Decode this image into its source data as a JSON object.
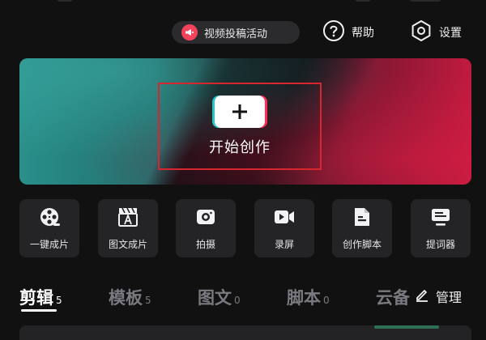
{
  "topbar": {
    "promo_label": "视频投稿活动",
    "help_label": "帮助",
    "settings_label": "设置"
  },
  "banner": {
    "create_label": "开始创作"
  },
  "tools": [
    {
      "label": "一键成片",
      "icon": "film-reel-icon"
    },
    {
      "label": "图文成片",
      "icon": "clapper-text-icon"
    },
    {
      "label": "拍摄",
      "icon": "camera-icon"
    },
    {
      "label": "录屏",
      "icon": "video-camera-icon"
    },
    {
      "label": "创作脚本",
      "icon": "script-document-icon"
    },
    {
      "label": "提词器",
      "icon": "teleprompter-icon"
    }
  ],
  "tabs": [
    {
      "label": "剪辑",
      "count": "5",
      "active": true
    },
    {
      "label": "模板",
      "count": "5",
      "active": false
    },
    {
      "label": "图文",
      "count": "0",
      "active": false
    },
    {
      "label": "脚本",
      "count": "0",
      "active": false
    },
    {
      "label": "云备",
      "count": "",
      "active": false
    }
  ],
  "manage_label": "管理",
  "colors": {
    "background": "#111112",
    "accent_red": "#f2435a",
    "highlight_box": "#d8262e",
    "tool_bg": "#242426",
    "teal": "#2a8f8a",
    "crimson": "#c01a3f"
  }
}
